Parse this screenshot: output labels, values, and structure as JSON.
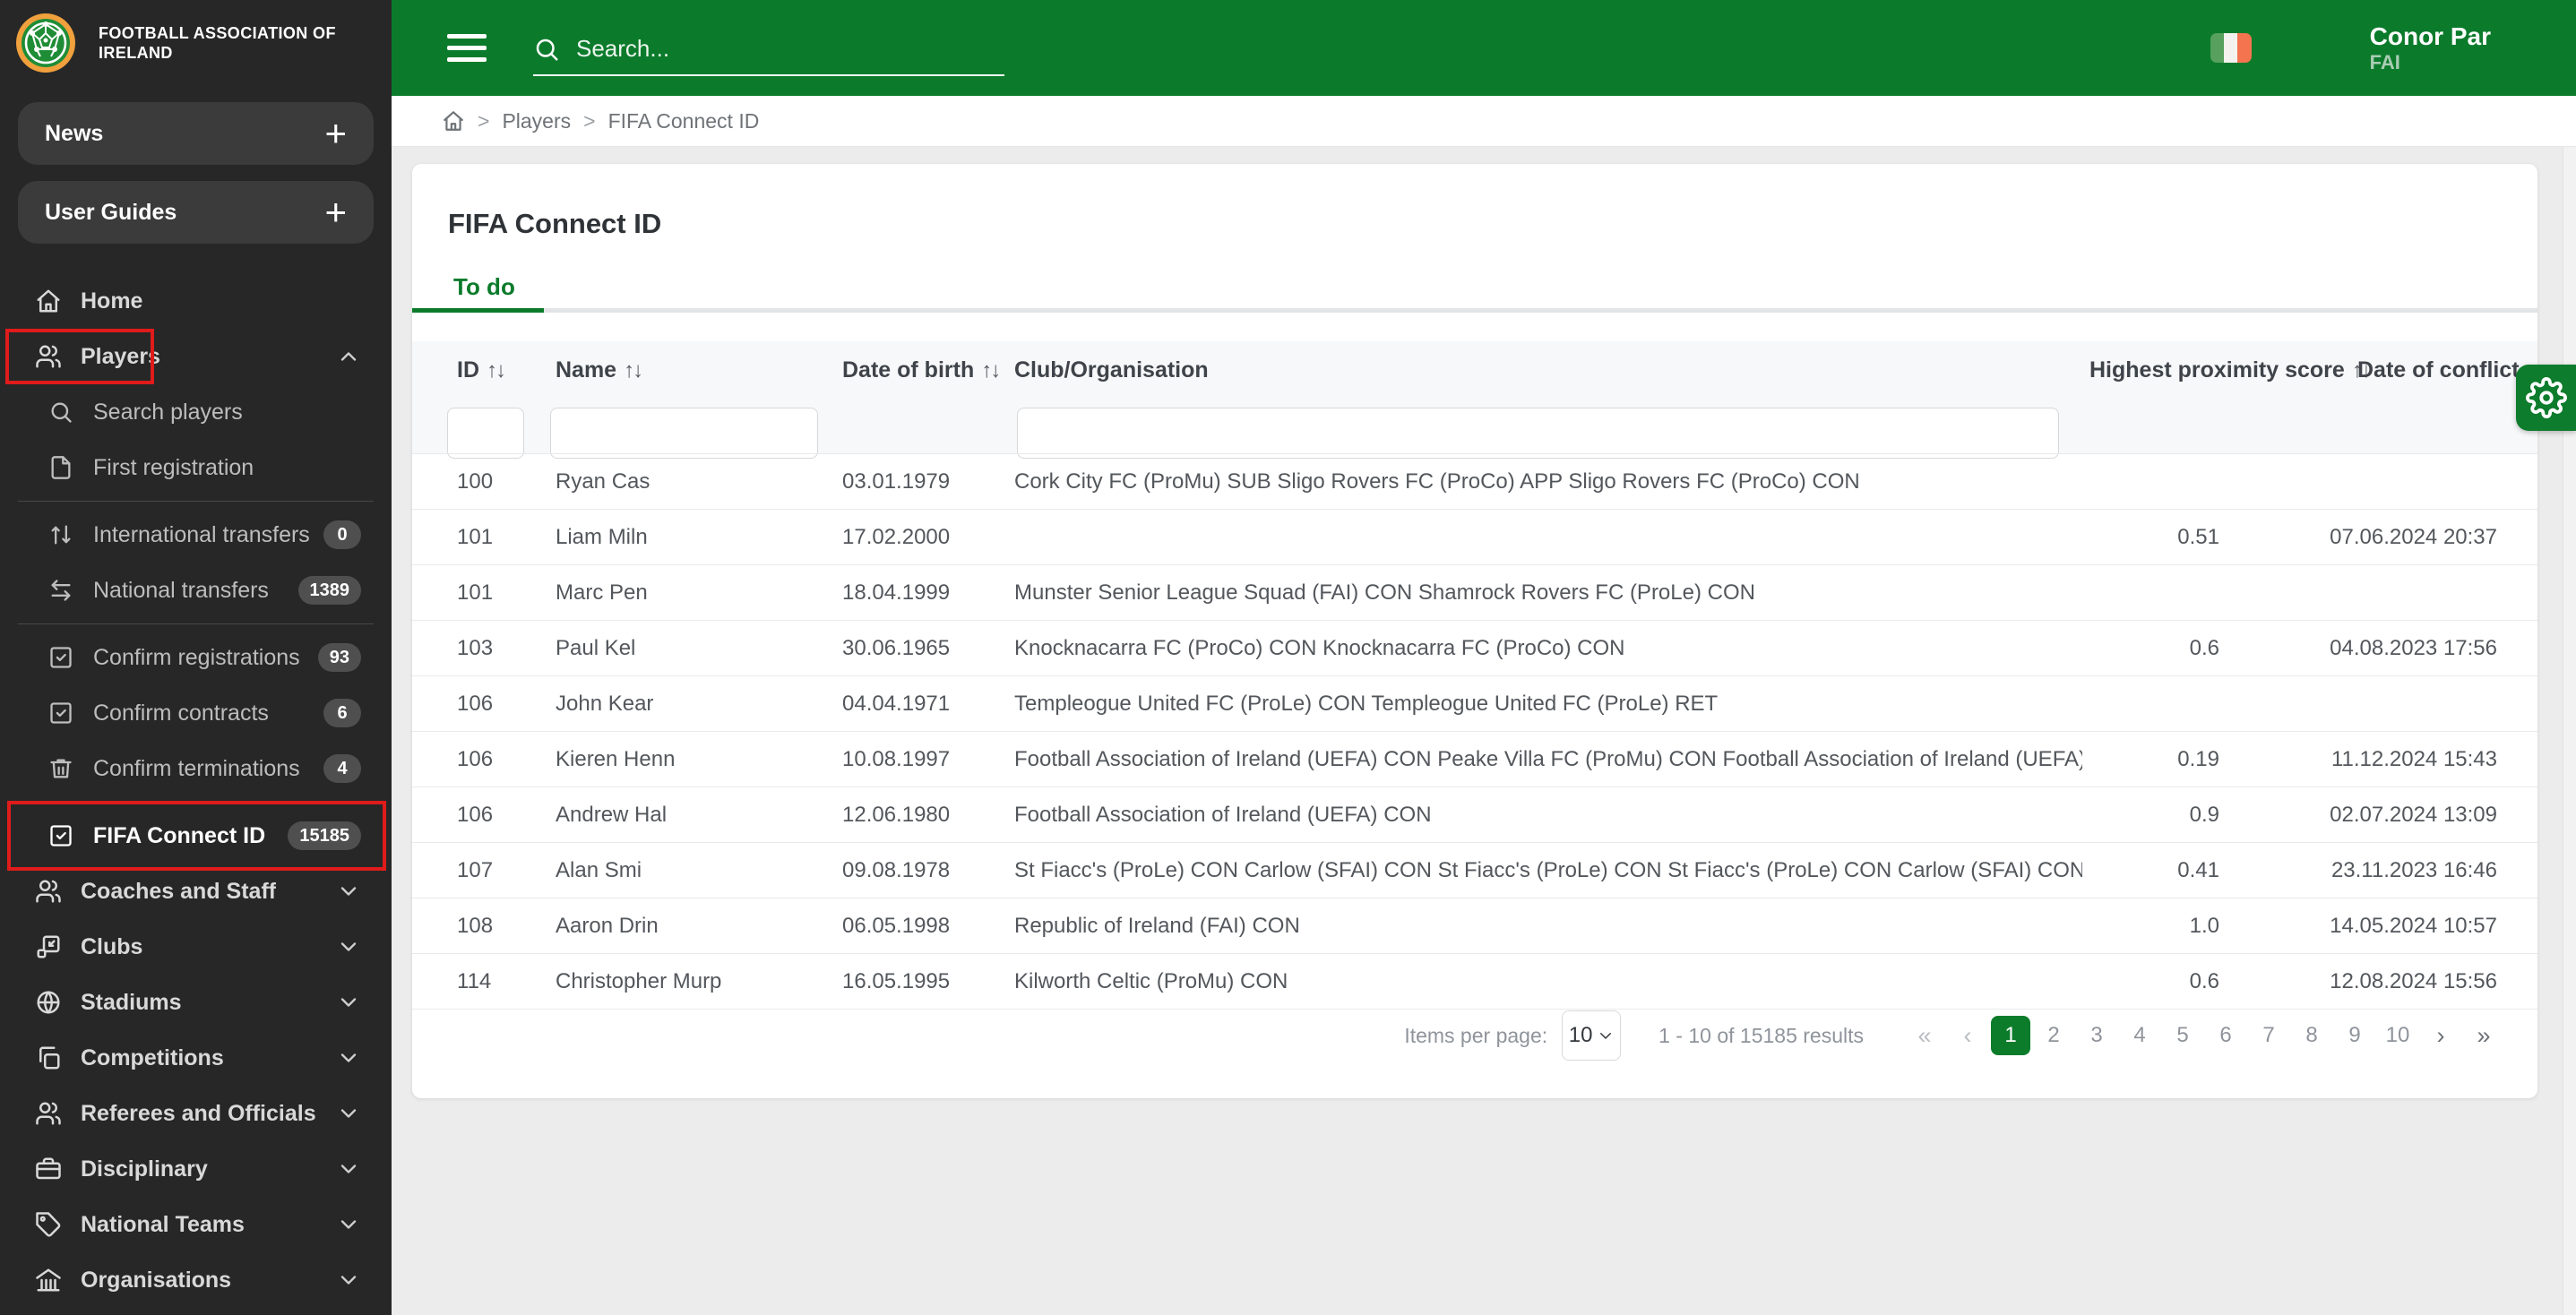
{
  "brand": {
    "org_name": "FOOTBALL ASSOCIATION OF IRELAND"
  },
  "topbar": {
    "search_placeholder": "Search...",
    "user": {
      "name": "Conor Par",
      "org": "FAI"
    }
  },
  "sidebar": {
    "panels": [
      {
        "label": "News",
        "action": "+"
      },
      {
        "label": "User Guides",
        "action": "+"
      }
    ],
    "nav": [
      {
        "label": "Home"
      },
      {
        "label": "Players"
      },
      {
        "label": "Search players"
      },
      {
        "label": "First registration"
      },
      {
        "label": "International transfers",
        "badge": "0"
      },
      {
        "label": "National transfers",
        "badge": "1389"
      },
      {
        "label": "Confirm registrations",
        "badge": "93"
      },
      {
        "label": "Confirm contracts",
        "badge": "6"
      },
      {
        "label": "Confirm terminations",
        "badge": "4"
      },
      {
        "label": "FIFA Connect ID",
        "badge": "15185"
      },
      {
        "label": "Coaches and Staff"
      },
      {
        "label": "Clubs"
      },
      {
        "label": "Stadiums"
      },
      {
        "label": "Competitions"
      },
      {
        "label": "Referees and Officials"
      },
      {
        "label": "Disciplinary"
      },
      {
        "label": "National Teams"
      },
      {
        "label": "Organisations"
      }
    ]
  },
  "breadcrumb": {
    "separator": ">",
    "items": [
      "Players",
      "FIFA Connect ID"
    ]
  },
  "page": {
    "title": "FIFA Connect ID"
  },
  "tabs": {
    "todo": "To do"
  },
  "table": {
    "sort_up": "↑",
    "sort_down": "↓",
    "columns": {
      "id": "ID",
      "name": "Name",
      "dob": "Date of birth",
      "club": "Club/Organisation",
      "proximity": "Highest proximity score",
      "conflict": "Date of conflict"
    },
    "rows": [
      {
        "id": "100",
        "name": "Ryan Cas",
        "dob": "03.01.1979",
        "club": "Cork City FC (ProMu) SUB Sligo Rovers FC (ProCo) APP Sligo Rovers FC (ProCo) CON",
        "score": "",
        "conflict": ""
      },
      {
        "id": "101",
        "name": "Liam Miln",
        "dob": "17.02.2000",
        "club": "",
        "score": "0.51",
        "conflict": "07.06.2024 20:37"
      },
      {
        "id": "101",
        "name": "Marc Pen",
        "dob": "18.04.1999",
        "club": "Munster Senior League Squad (FAI) CON Shamrock Rovers FC (ProLe) CON",
        "score": "",
        "conflict": ""
      },
      {
        "id": "103",
        "name": "Paul Kel",
        "dob": "30.06.1965",
        "club": "Knocknacarra FC (ProCo) CON Knocknacarra FC (ProCo) CON",
        "score": "0.6",
        "conflict": "04.08.2023 17:56"
      },
      {
        "id": "106",
        "name": "John Kear",
        "dob": "04.04.1971",
        "club": "Templeogue United FC (ProLe) CON Templeogue United FC (ProLe) RET",
        "score": "",
        "conflict": ""
      },
      {
        "id": "106",
        "name": "Kieren Henn",
        "dob": "10.08.1997",
        "club": "Football Association of Ireland (UEFA) CON Peake Villa FC (ProMu) CON Football Association of Ireland (UEFA) CON",
        "score": "0.19",
        "conflict": "11.12.2024 15:43"
      },
      {
        "id": "106",
        "name": "Andrew Hal",
        "dob": "12.06.1980",
        "club": "Football Association of Ireland (UEFA) CON",
        "score": "0.9",
        "conflict": "02.07.2024 13:09"
      },
      {
        "id": "107",
        "name": "Alan Smi",
        "dob": "09.08.1978",
        "club": "St Fiacc's (ProLe) CON Carlow (SFAI) CON St Fiacc's (ProLe) CON St Fiacc's (ProLe) CON Carlow (SFAI) CON",
        "score": "0.41",
        "conflict": "23.11.2023 16:46"
      },
      {
        "id": "108",
        "name": "Aaron Drin",
        "dob": "06.05.1998",
        "club": "Republic of Ireland (FAI) CON",
        "score": "1.0",
        "conflict": "14.05.2024 10:57"
      },
      {
        "id": "114",
        "name": "Christopher Murp",
        "dob": "16.05.1995",
        "club": "Kilworth Celtic (ProMu) CON",
        "score": "0.6",
        "conflict": "12.08.2024 15:56"
      }
    ]
  },
  "pagination": {
    "items_per_page_label": "Items per page:",
    "page_size": "10",
    "results": "1 - 10 of 15185 results",
    "first": "«",
    "prev": "‹",
    "next": "›",
    "last": "»",
    "pages": [
      "1",
      "2",
      "3",
      "4",
      "5",
      "6",
      "7",
      "8",
      "9",
      "10"
    ],
    "active_page": "1"
  },
  "colors": {
    "green": "#0b7b2b",
    "annotation_red": "#e01b1b"
  }
}
